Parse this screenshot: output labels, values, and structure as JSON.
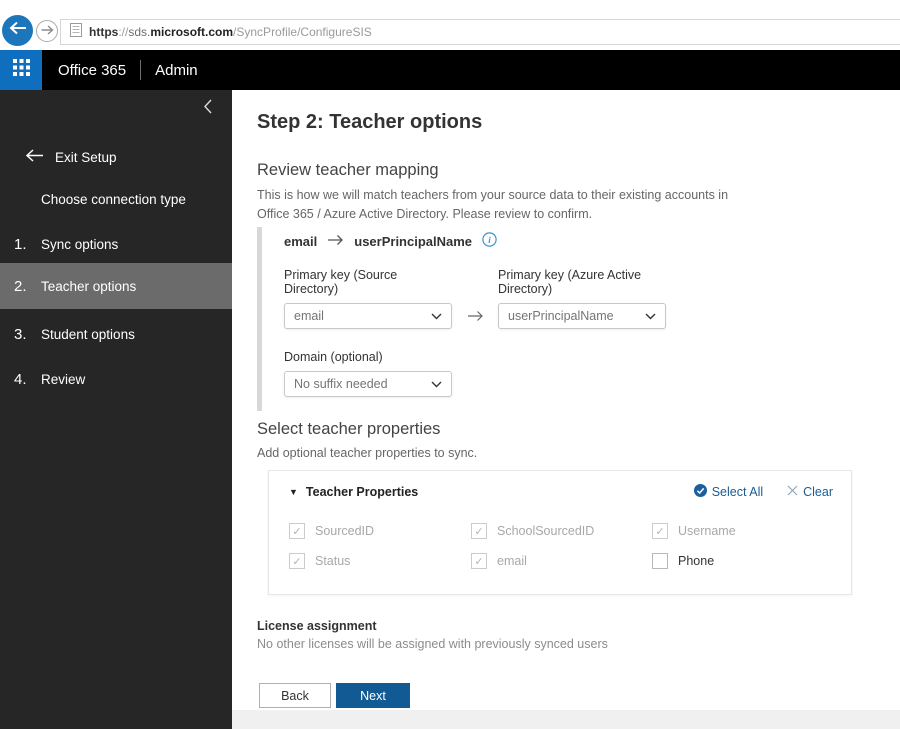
{
  "browser": {
    "url_scheme": "https",
    "url_sep": "://",
    "url_subdomain": "sds.",
    "url_domain": "microsoft.com",
    "url_path": "/SyncProfile/ConfigureSIS"
  },
  "header": {
    "brand": "Office 365",
    "section": "Admin"
  },
  "sidebar": {
    "exit_label": "Exit Setup",
    "items": [
      {
        "number": "",
        "label": "Choose connection type",
        "active": false
      },
      {
        "number": "1.",
        "label": "Sync options",
        "active": false
      },
      {
        "number": "2.",
        "label": "Teacher options",
        "active": true
      },
      {
        "number": "3.",
        "label": "Student options",
        "active": false
      },
      {
        "number": "4.",
        "label": "Review",
        "active": false
      }
    ]
  },
  "main": {
    "title": "Step 2: Teacher options",
    "mapping": {
      "heading": "Review teacher mapping",
      "description": "This is how we will match teachers from your source data to their existing accounts in Office 365 / Azure Active Directory. Please review to confirm.",
      "summary_source": "email",
      "summary_target": "userPrincipalName",
      "source_label": "Primary key (Source Directory)",
      "target_label": "Primary key (Azure Active Directory)",
      "source_dropdown_value": "email",
      "target_dropdown_value": "userPrincipalName",
      "domain_label": "Domain (optional)",
      "domain_dropdown_value": "No suffix needed"
    },
    "properties": {
      "heading": "Select teacher properties",
      "description": "Add optional teacher properties to sync.",
      "panel_title": "Teacher Properties",
      "select_all_label": "Select All",
      "clear_label": "Clear",
      "checkboxes": [
        {
          "label": "SourcedID",
          "checked": true,
          "disabled": true
        },
        {
          "label": "SchoolSourcedID",
          "checked": true,
          "disabled": true
        },
        {
          "label": "Username",
          "checked": true,
          "disabled": true
        },
        {
          "label": "Status",
          "checked": true,
          "disabled": true
        },
        {
          "label": "email",
          "checked": true,
          "disabled": true
        },
        {
          "label": "Phone",
          "checked": false,
          "disabled": false
        }
      ]
    },
    "license": {
      "heading": "License assignment",
      "description": "No other licenses will be assigned with previously synced users"
    },
    "back_label": "Back",
    "next_label": "Next"
  },
  "icons": {
    "back_arrow": "←",
    "forward_arrow": "→",
    "app_launcher": "grid-3x3",
    "collapse_chevron": "❮",
    "exit_arrow": "←",
    "mapping_arrow": "→",
    "info": "ⓘ",
    "dropdown_chevron": "⌄",
    "section_triangle": "▼",
    "select_all_check": "✓",
    "clear_x": "✕",
    "checkbox_check": "✓"
  },
  "colors": {
    "launcher_blue": "#106ebe",
    "back_circle_blue": "#1b76bb",
    "next_button_blue": "#125a94",
    "link_blue": "#1a5c94",
    "info_icon_blue": "#3a96d2",
    "sidebar_bg": "#262626",
    "sidebar_active": "#6b6b6b"
  }
}
